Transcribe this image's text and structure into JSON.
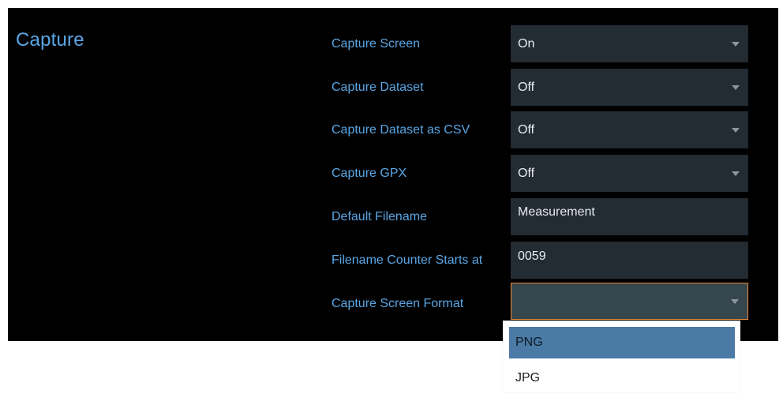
{
  "section": {
    "title": "Capture"
  },
  "settings": [
    {
      "label": "Capture Screen",
      "value": "On",
      "type": "select"
    },
    {
      "label": "Capture Dataset",
      "value": "Off",
      "type": "select"
    },
    {
      "label": "Capture Dataset as CSV",
      "value": "Off",
      "type": "select"
    },
    {
      "label": "Capture GPX",
      "value": "Off",
      "type": "select"
    },
    {
      "label": "Default Filename",
      "value": "Measurement",
      "type": "text"
    },
    {
      "label": "Filename Counter Starts at",
      "value": "0059",
      "type": "text"
    },
    {
      "label": "Capture Screen Format",
      "value": "",
      "type": "select"
    }
  ],
  "format_dropdown": {
    "options": [
      "PNG",
      "JPG"
    ],
    "highlighted": "PNG"
  },
  "colors": {
    "background": "#000000",
    "label": "#5aa7e6",
    "field": "#232b33",
    "focus_border": "#e8893a",
    "highlight": "#4a7aa5"
  }
}
